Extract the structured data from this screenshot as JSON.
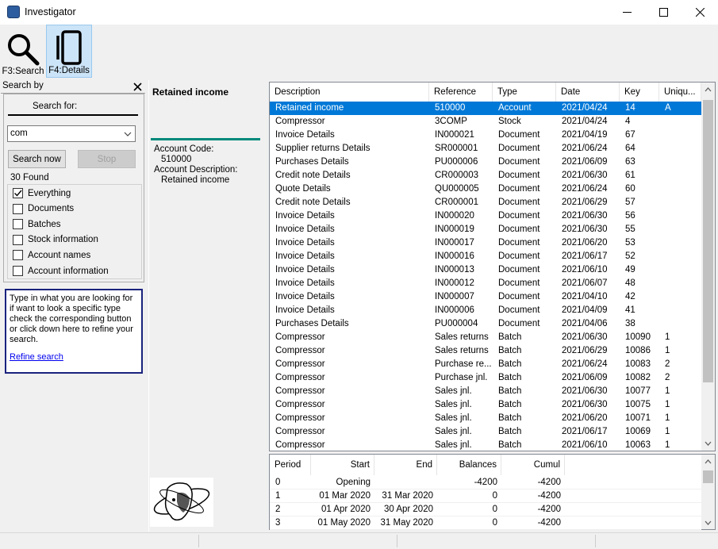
{
  "window": {
    "title": "Investigator",
    "minimize": "─",
    "maximize": "☐",
    "close": "✕"
  },
  "toolbar": {
    "search_label": "F3:Search",
    "details_label": "F4:Details"
  },
  "search_panel": {
    "header": "Search by",
    "close": "✕",
    "search_for_label": "Search for:",
    "search_value": "com",
    "search_now": "Search now",
    "stop": "Stop",
    "found": "30 Found",
    "options": [
      {
        "label": "Everything",
        "checked": true
      },
      {
        "label": "Documents",
        "checked": false
      },
      {
        "label": "Batches",
        "checked": false
      },
      {
        "label": "Stock information",
        "checked": false
      },
      {
        "label": "Account names",
        "checked": false
      },
      {
        "label": "Account information",
        "checked": false
      }
    ],
    "hint_text": "Type in what you are looking for if want to look a specific type check the corresponding button or click down here to refine your search.",
    "refine_link": "Refine search"
  },
  "details": {
    "title": "Retained income",
    "code_label": "Account Code:",
    "code_value": "510000",
    "desc_label": "Account Description:",
    "desc_value": "Retained income",
    "accent_color": "#00897b"
  },
  "results": {
    "columns": [
      "Description",
      "Reference",
      "Type",
      "Date",
      "Key",
      "Uniqu..."
    ],
    "rows": [
      [
        "Retained income",
        "510000",
        "Account",
        "2021/04/24",
        "14",
        "A"
      ],
      [
        "Compressor",
        "3COMP",
        "Stock",
        "2021/04/24",
        "4",
        ""
      ],
      [
        "Invoice Details",
        "IN000021",
        "Document",
        "2021/04/19",
        "67",
        ""
      ],
      [
        "Supplier returns Details",
        "SR000001",
        "Document",
        "2021/06/24",
        "64",
        ""
      ],
      [
        "Purchases Details",
        "PU000006",
        "Document",
        "2021/06/09",
        "63",
        ""
      ],
      [
        "Credit note Details",
        "CR000003",
        "Document",
        "2021/06/30",
        "61",
        ""
      ],
      [
        "Quote Details",
        "QU000005",
        "Document",
        "2021/06/24",
        "60",
        ""
      ],
      [
        "Credit note Details",
        "CR000001",
        "Document",
        "2021/06/29",
        "57",
        ""
      ],
      [
        "Invoice Details",
        "IN000020",
        "Document",
        "2021/06/30",
        "56",
        ""
      ],
      [
        "Invoice Details",
        "IN000019",
        "Document",
        "2021/06/30",
        "55",
        ""
      ],
      [
        "Invoice Details",
        "IN000017",
        "Document",
        "2021/06/20",
        "53",
        ""
      ],
      [
        "Invoice Details",
        "IN000016",
        "Document",
        "2021/06/17",
        "52",
        ""
      ],
      [
        "Invoice Details",
        "IN000013",
        "Document",
        "2021/06/10",
        "49",
        ""
      ],
      [
        "Invoice Details",
        "IN000012",
        "Document",
        "2021/06/07",
        "48",
        ""
      ],
      [
        "Invoice Details",
        "IN000007",
        "Document",
        "2021/04/10",
        "42",
        ""
      ],
      [
        "Invoice Details",
        "IN000006",
        "Document",
        "2021/04/09",
        "41",
        ""
      ],
      [
        "Purchases Details",
        "PU000004",
        "Document",
        "2021/04/06",
        "38",
        ""
      ],
      [
        "Compressor",
        "Sales returns",
        "Batch",
        "2021/06/30",
        "10090",
        "1"
      ],
      [
        "Compressor",
        "Sales returns",
        "Batch",
        "2021/06/29",
        "10086",
        "1"
      ],
      [
        "Compressor",
        "Purchase re...",
        "Batch",
        "2021/06/24",
        "10083",
        "2"
      ],
      [
        "Compressor",
        "Purchase jnl.",
        "Batch",
        "2021/06/09",
        "10082",
        "2"
      ],
      [
        "Compressor",
        "Sales jnl.",
        "Batch",
        "2021/06/30",
        "10077",
        "1"
      ],
      [
        "Compressor",
        "Sales jnl.",
        "Batch",
        "2021/06/30",
        "10075",
        "1"
      ],
      [
        "Compressor",
        "Sales jnl.",
        "Batch",
        "2021/06/20",
        "10071",
        "1"
      ],
      [
        "Compressor",
        "Sales jnl.",
        "Batch",
        "2021/06/17",
        "10069",
        "1"
      ],
      [
        "Compressor",
        "Sales jnl.",
        "Batch",
        "2021/06/10",
        "10063",
        "1"
      ]
    ]
  },
  "balances": {
    "columns": [
      "Period",
      "Start",
      "End",
      "Balances",
      "Cumul"
    ],
    "rows": [
      [
        "0",
        "Opening",
        "",
        "-4200",
        "-4200"
      ],
      [
        "1",
        "01 Mar 2020",
        "31 Mar 2020",
        "0",
        "-4200"
      ],
      [
        "2",
        "01 Apr 2020",
        "30 Apr 2020",
        "0",
        "-4200"
      ],
      [
        "3",
        "01 May 2020",
        "31 May 2020",
        "0",
        "-4200"
      ]
    ]
  },
  "scroll_arrows": {
    "up": "⌃",
    "down": "⌄"
  }
}
